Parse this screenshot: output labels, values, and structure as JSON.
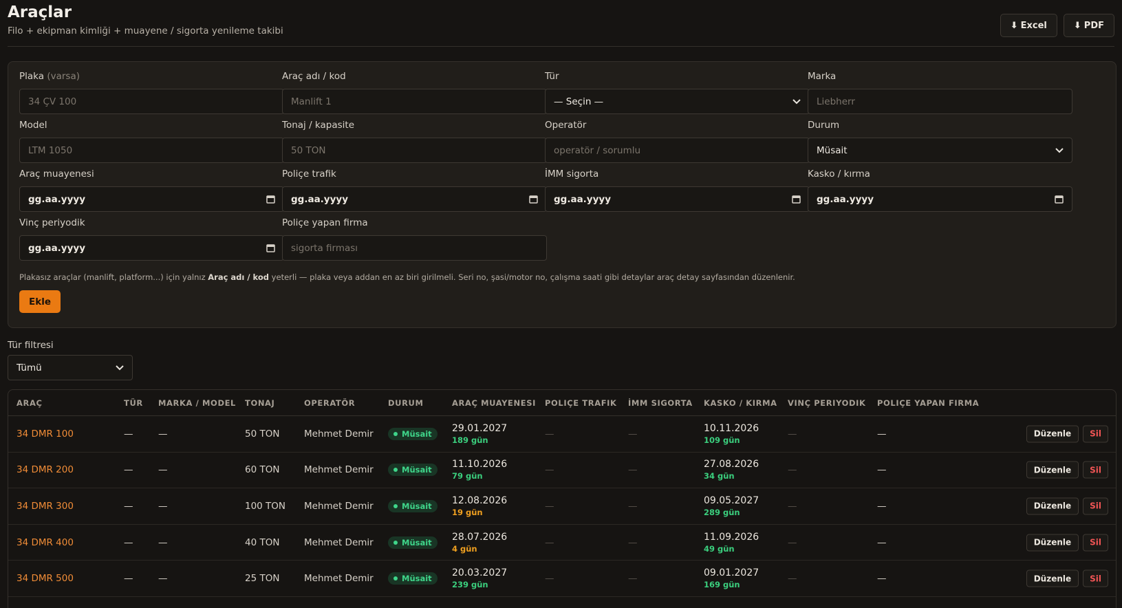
{
  "header": {
    "title": "Araçlar",
    "subtitle": "Filo + ekipman kimliği + muayene / sigorta yenileme takibi",
    "excel_label": "Excel",
    "pdf_label": "PDF",
    "download_glyph": "⬇"
  },
  "form": {
    "plaka": {
      "label": "Plaka",
      "label_hint": "(varsa)",
      "placeholder": "34 ÇV 100"
    },
    "arac_adi": {
      "label": "Araç adı / kod",
      "placeholder": "Manlift 1"
    },
    "tur": {
      "label": "Tür",
      "value": "— Seçin —"
    },
    "marka": {
      "label": "Marka",
      "placeholder": "Liebherr"
    },
    "model": {
      "label": "Model",
      "placeholder": "LTM 1050"
    },
    "tonaj": {
      "label": "Tonaj / kapasite",
      "placeholder": "50 TON"
    },
    "operator": {
      "label": "Operatör",
      "placeholder": "operatör / sorumlu"
    },
    "durum": {
      "label": "Durum",
      "value": "Müsait"
    },
    "arac_muayenesi": {
      "label": "Araç muayenesi",
      "value": "gg.aa.yyyy"
    },
    "police_trafik": {
      "label": "Poliçe trafik",
      "value": "gg.aa.yyyy"
    },
    "imm_sigorta": {
      "label": "İMM sigorta",
      "value": "gg.aa.yyyy"
    },
    "kasko": {
      "label": "Kasko / kırma",
      "value": "gg.aa.yyyy"
    },
    "vinc_periyodik": {
      "label": "Vinç periyodik",
      "value": "gg.aa.yyyy"
    },
    "police_firma": {
      "label": "Poliçe yapan firma",
      "placeholder": "sigorta firması"
    },
    "helper_pre": "Plakasız araçlar (manlift, platform...) için yalnız ",
    "helper_bold": "Araç adı / kod",
    "helper_post": " yeterli — plaka veya addan en az biri girilmeli. Seri no, şasi/motor no, çalışma saati gibi detaylar araç detay sayfasından düzenlenir.",
    "add_label": "Ekle"
  },
  "filter": {
    "label": "Tür filtresi",
    "value": "Tümü"
  },
  "table": {
    "headers": {
      "arac": "Araç",
      "tur": "Tür",
      "marka_model": "Marka / Model",
      "tonaj": "Tonaj",
      "operator": "Operatör",
      "durum": "Durum",
      "arac_muayenesi": "Araç muayenesi",
      "police_trafik": "Poliçe trafik",
      "imm_sigorta": "İMM sigorta",
      "kasko": "Kasko / kırma",
      "vinc_periyodik": "Vinç periyodik",
      "police_firma": "Poliçe yapan firma"
    },
    "empty": "—",
    "edit_label": "Düzenle",
    "delete_label": "Sil",
    "rows": [
      {
        "plate": "34 DMR 100",
        "tonaj": "50 TON",
        "operator": "Mehmet Demir",
        "durum": "Müsait",
        "muayene_date": "29.01.2027",
        "muayene_days": "189 gün",
        "muayene_color": "#3bcf7e",
        "kasko_date": "10.11.2026",
        "kasko_days": "109 gün",
        "kasko_color": "#3bcf7e"
      },
      {
        "plate": "34 DMR 200",
        "tonaj": "60 TON",
        "operator": "Mehmet Demir",
        "durum": "Müsait",
        "muayene_date": "11.10.2026",
        "muayene_days": "79 gün",
        "muayene_color": "#3bcf7e",
        "kasko_date": "27.08.2026",
        "kasko_days": "34 gün",
        "kasko_color": "#3bcf7e"
      },
      {
        "plate": "34 DMR 300",
        "tonaj": "100 TON",
        "operator": "Mehmet Demir",
        "durum": "Müsait",
        "muayene_date": "12.08.2026",
        "muayene_days": "19 gün",
        "muayene_color": "#f0a020",
        "kasko_date": "09.05.2027",
        "kasko_days": "289 gün",
        "kasko_color": "#3bcf7e"
      },
      {
        "plate": "34 DMR 400",
        "tonaj": "40 TON",
        "operator": "Mehmet Demir",
        "durum": "Müsait",
        "muayene_date": "28.07.2026",
        "muayene_days": "4 gün",
        "muayene_color": "#f0a020",
        "kasko_date": "11.09.2026",
        "kasko_days": "49 gün",
        "kasko_color": "#3bcf7e"
      },
      {
        "plate": "34 DMR 500",
        "tonaj": "25 TON",
        "operator": "Mehmet Demir",
        "durum": "Müsait",
        "muayene_date": "20.03.2027",
        "muayene_days": "239 gün",
        "muayene_color": "#3bcf7e",
        "kasko_date": "09.01.2027",
        "kasko_days": "169 gün",
        "kasko_color": "#3bcf7e"
      }
    ]
  },
  "icons": {
    "download": "download-icon",
    "chevron": "chevron-down-icon",
    "calendar": "calendar-icon"
  },
  "colors": {
    "accent": "#ea7a12",
    "plate": "#f08c37",
    "ok": "#3bcf7e",
    "warn": "#f0a020",
    "danger": "#f25555"
  }
}
